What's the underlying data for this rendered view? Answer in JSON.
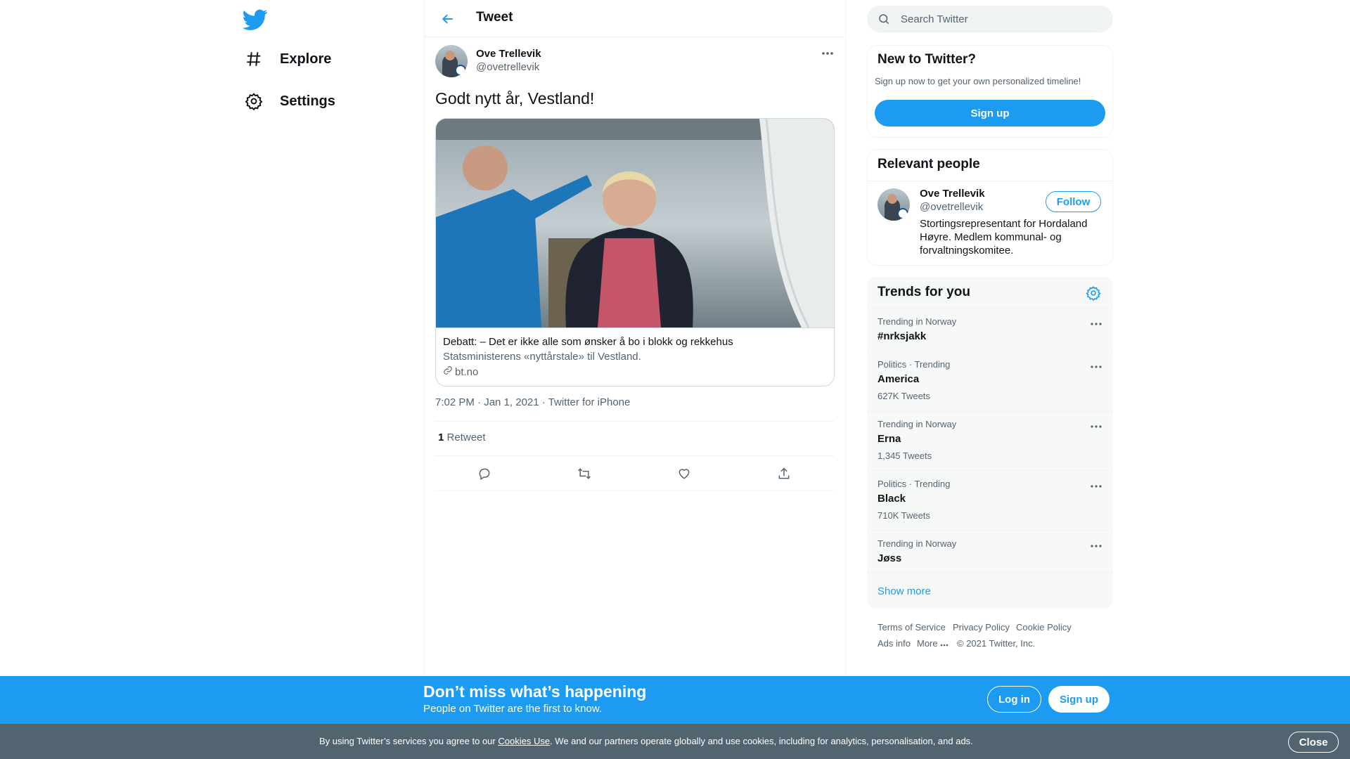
{
  "nav": {
    "items": [
      {
        "label": "Explore",
        "icon": "hashtag-icon"
      },
      {
        "label": "Settings",
        "icon": "gear-icon"
      }
    ]
  },
  "header": {
    "title": "Tweet"
  },
  "tweet": {
    "author_name": "Ove Trellevik",
    "author_handle": "@ovetrellevik",
    "text": "Godt nytt år, Vestland!",
    "card": {
      "title": "Debatt: – Det er ikke alle som ønsker å bo i blokk og rekkehus",
      "description": "Statsministerens «nyttårstale» til Vestland.",
      "domain": "bt.no"
    },
    "meta": "7:02 PM · Jan 1, 2021 · Twitter for iPhone",
    "retweet_count": "1",
    "retweet_label": "Retweet"
  },
  "search": {
    "placeholder": "Search Twitter"
  },
  "new_to_twitter": {
    "title": "New to Twitter?",
    "subtitle": "Sign up now to get your own personalized timeline!",
    "signup_label": "Sign up"
  },
  "relevant_people": {
    "title": "Relevant people",
    "name": "Ove Trellevik",
    "handle": "@ovetrellevik",
    "follow_label": "Follow",
    "bio_line1": "Stortingsrepresentant for Hordaland",
    "bio_line2": "Høyre. Medlem kommunal- og",
    "bio_line3": "forvaltningskomitee."
  },
  "trends": {
    "title": "Trends for you",
    "items": [
      {
        "context": "Trending in Norway",
        "name": "#nrksjakk",
        "count": ""
      },
      {
        "context": "Politics · Trending",
        "name": "America",
        "count": "627K Tweets"
      },
      {
        "context": "Trending in Norway",
        "name": "Erna",
        "count": "1,345 Tweets"
      },
      {
        "context": "Politics · Trending",
        "name": "Black",
        "count": "710K Tweets"
      },
      {
        "context": "Trending in Norway",
        "name": "Jøss",
        "count": ""
      }
    ],
    "show_more": "Show more"
  },
  "footer": {
    "terms": "Terms of Service",
    "privacy": "Privacy Policy",
    "cookie": "Cookie Policy",
    "ads": "Ads info",
    "more": "More",
    "copyright": "© 2021 Twitter, Inc."
  },
  "banner": {
    "title": "Don’t miss what’s happening",
    "subtitle": "People on Twitter are the first to know.",
    "login_label": "Log in",
    "signup_label": "Sign up"
  },
  "cookie_bar": {
    "text_before": "By using Twitter’s services you agree to our ",
    "link": "Cookies Use",
    "text_after": ". We and our partners operate globally and use cookies, including for analytics, personalisation, and ads.",
    "close_label": "Close"
  },
  "colors": {
    "accent": "#1d9bf0",
    "secondary_text": "#536471",
    "cookie_bg": "#536471"
  }
}
